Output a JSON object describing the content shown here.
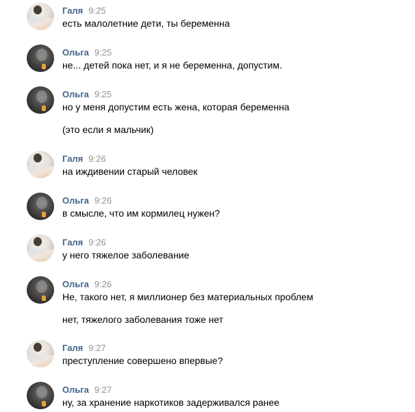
{
  "messages": [
    {
      "author": "Галя",
      "time": "9:25",
      "lines": [
        "есть малолетние дети, ты беременна"
      ]
    },
    {
      "author": "Ольга",
      "time": "9:25",
      "lines": [
        "не... детей пока нет, и я не беременна, допустим."
      ]
    },
    {
      "author": "Ольга",
      "time": "9:25",
      "lines": [
        "но у меня допустим есть жена, которая беременна",
        "(это если я мальчик)"
      ]
    },
    {
      "author": "Галя",
      "time": "9:26",
      "lines": [
        "на иждивении старый человек"
      ]
    },
    {
      "author": "Ольга",
      "time": "9:26",
      "lines": [
        "в смысле, что им кормилец нужен?"
      ]
    },
    {
      "author": "Галя",
      "time": "9:26",
      "lines": [
        "у него тяжелое заболевание"
      ]
    },
    {
      "author": "Ольга",
      "time": "9:26",
      "lines": [
        "Не, такого нет, я миллионер без материальных проблем",
        "нет, тяжелого заболевания тоже нет"
      ]
    },
    {
      "author": "Галя",
      "time": "9:27",
      "lines": [
        "преступление совершено впервые?"
      ]
    },
    {
      "author": "Ольга",
      "time": "9:27",
      "lines": [
        "ну, за хранение наркотиков задерживался ранее"
      ]
    }
  ],
  "colors": {
    "author_name": "#42648b",
    "timestamp": "#939393",
    "text": "#000000",
    "background": "#ffffff"
  }
}
